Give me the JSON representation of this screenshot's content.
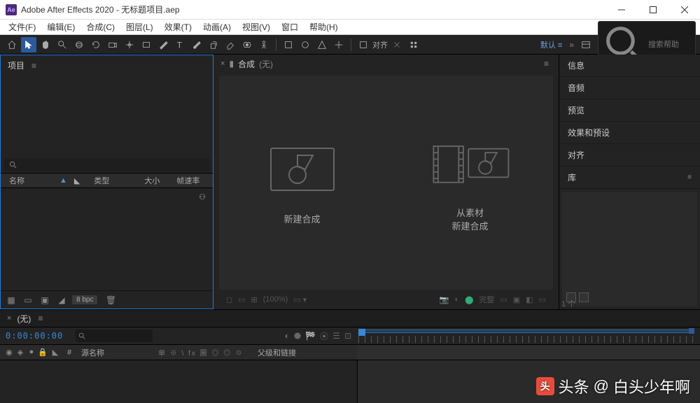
{
  "titlebar": {
    "app_icon_text": "Ae",
    "title": "Adobe After Effects 2020 - 无标题项目.aep"
  },
  "menubar": {
    "items": [
      "文件(F)",
      "编辑(E)",
      "合成(C)",
      "图层(L)",
      "效果(T)",
      "动画(A)",
      "视图(V)",
      "窗口",
      "帮助(H)"
    ]
  },
  "toolbar": {
    "snap_label": "对齐",
    "workspace": "默认",
    "search_placeholder": "搜索帮助"
  },
  "project": {
    "panel_title": "项目",
    "columns": {
      "name": "名称",
      "sort_icon": "▲",
      "tag": "◣",
      "type": "类型",
      "size": "大小",
      "fps": "帧速率"
    },
    "bpc": "8 bpc"
  },
  "composition": {
    "tab_prefix": "合成",
    "tab_none": "(无)",
    "new_comp": "新建合成",
    "from_footage_l1": "从素材",
    "from_footage_l2": "新建合成",
    "zoom": "(100%)",
    "res": "完整"
  },
  "right_panels": {
    "items": [
      "信息",
      "音频",
      "预览",
      "效果和预设",
      "对齐",
      "库"
    ],
    "footer_count": "1 个"
  },
  "timeline": {
    "tab_none": "(无)",
    "timecode": "0:00:00:00",
    "columns": {
      "num": "#",
      "source_name": "源名称",
      "switches": "单 ※ \\ fx 圖 ◎ ◎ ☉",
      "parent": "父级和链接"
    }
  },
  "watermark": {
    "prefix": "头条",
    "at": "@",
    "name": "白头少年啊"
  }
}
